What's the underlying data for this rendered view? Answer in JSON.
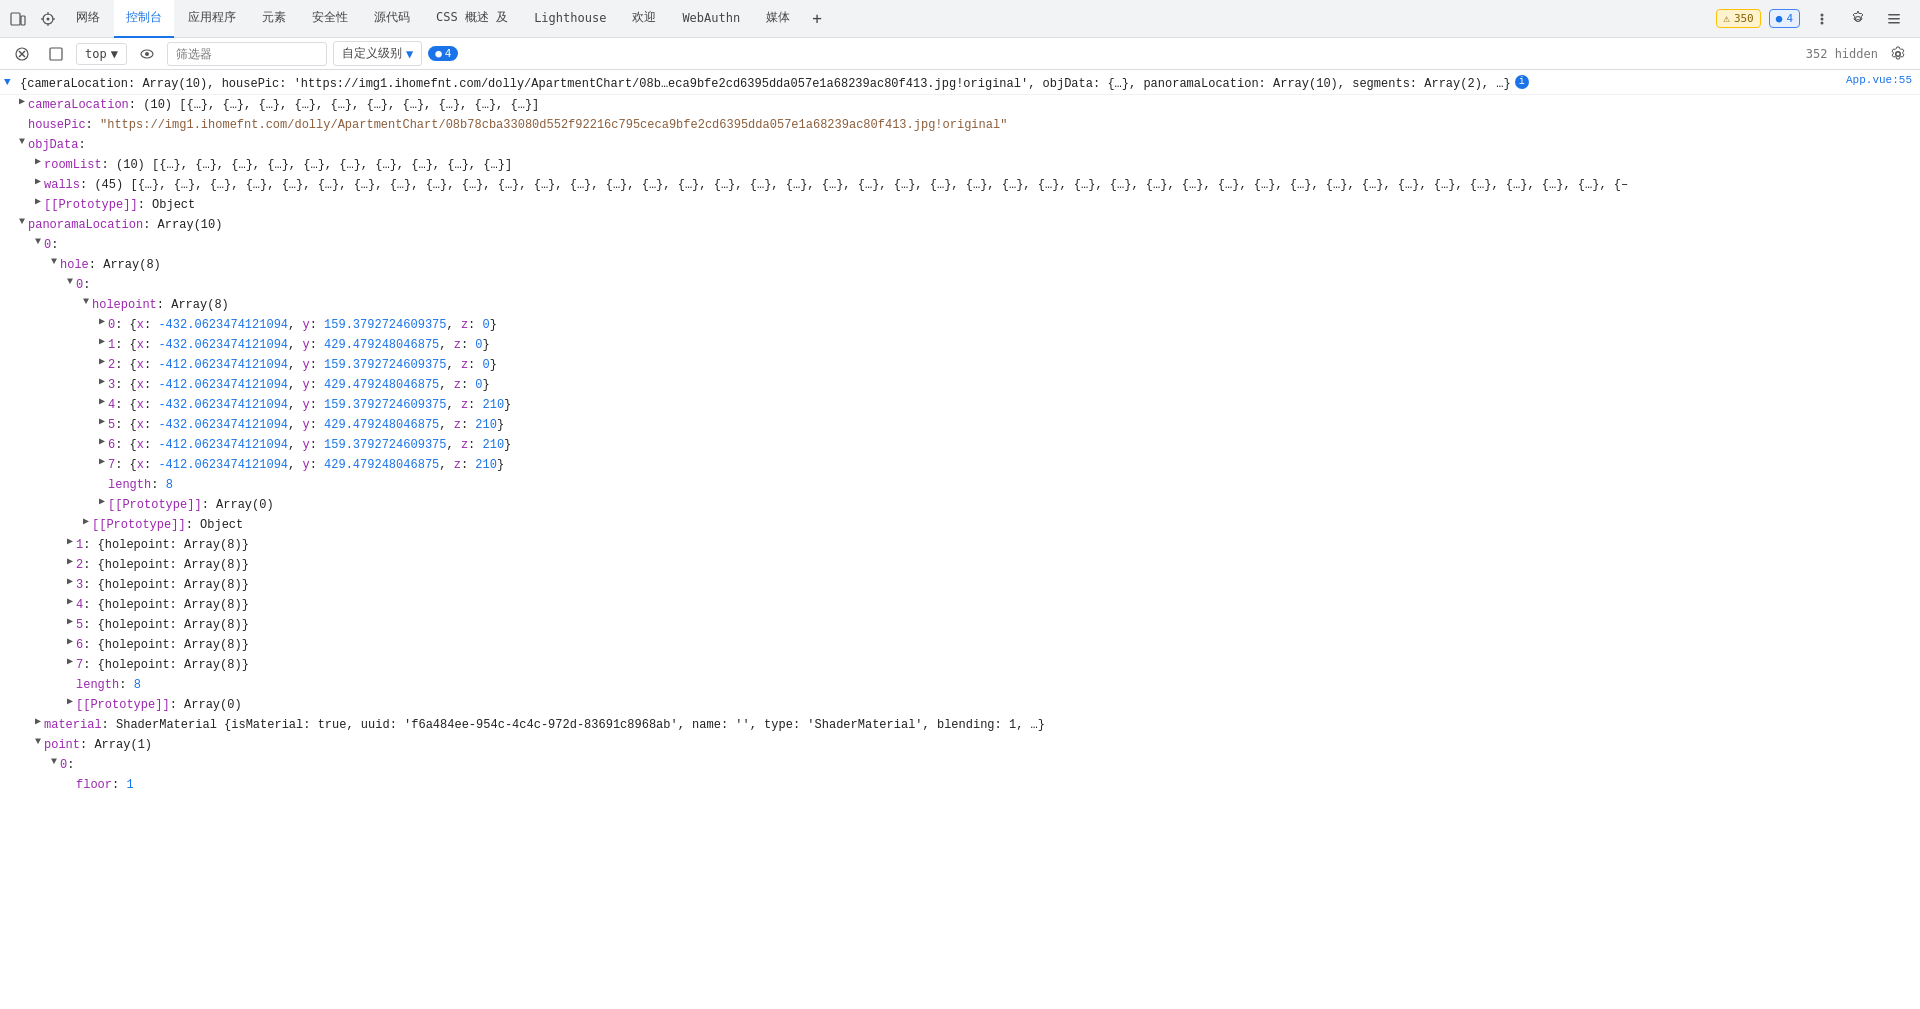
{
  "tabs": [
    {
      "label": "网络",
      "active": false
    },
    {
      "label": "控制台",
      "active": true
    },
    {
      "label": "应用程序",
      "active": false
    },
    {
      "label": "元素",
      "active": false
    },
    {
      "label": "安全性",
      "active": false
    },
    {
      "label": "源代码",
      "active": false
    },
    {
      "label": "CSS 概述 及",
      "active": false
    },
    {
      "label": "Lighthouse",
      "active": false
    },
    {
      "label": "欢迎",
      "active": false
    },
    {
      "label": "WebAuthn",
      "active": false
    },
    {
      "label": "媒体",
      "active": false
    }
  ],
  "topRight": {
    "warningCount": "350",
    "infoCount": "4",
    "hiddenCount": "352 hidden"
  },
  "toolbar": {
    "topLabel": "top",
    "filterPlaceholder": "筛选器",
    "levelLabel": "自定义级别",
    "bubbleCount": "4"
  },
  "source": "App.vue:55",
  "console": {
    "mainLine": "{cameraLocation: Array(10), housePic: 'https://img1.ihomefnt.com/dolly/ApartmentChart/08b…eca9bfe2cd6395dda057e1a68239ac80f413.jpg!original', objData: {…}, panoramaLocation: Array(10), segments: Array(2), …}",
    "lines": [
      {
        "indent": 1,
        "expander": "collapsed",
        "text": "cameraLocation: (10) [{…}, {…}, {…}, {…}, {…}, {…}, {…}, {…}, {…}, {…}]"
      },
      {
        "indent": 1,
        "expander": "none",
        "text": "housePic: \"https://img1.ihomefnt.com/dolly/ApartmentChart/08b78cba33080d552f92216c795ceca9bfe2cd6395dda057e1a68239ac80f413.jpg!original\""
      },
      {
        "indent": 1,
        "expander": "expanded",
        "text": "objData:"
      },
      {
        "indent": 2,
        "expander": "collapsed",
        "text": "roomList: (10) [{…}, {…}, {…}, {…}, {…}, {…}, {…}, {…}, {…}, {…}]"
      },
      {
        "indent": 2,
        "expander": "collapsed",
        "text": "walls: (45) [{…}, {…}, {…}, {…}, {…}, {…}, {…}, {…}, {…}, {…}, {…}, {…}, {…}, {…}, {…}, {…}, {…}, {…}, {…}, {…}, {…}, {…}, {…}, {…}, {…}, {…}, {…}, {…}, {…}, {…}, {…}, {…}, {…}, {…}, {…}, {…}, {…}, {…}, {…}, {…}, {…}, {…}, {…}, {…}, {…}, {…}, {–"
      },
      {
        "indent": 2,
        "expander": "collapsed",
        "text": "[[Prototype]]: Object"
      },
      {
        "indent": 1,
        "expander": "expanded",
        "text": "panoramaLocation: Array(10)"
      },
      {
        "indent": 2,
        "expander": "expanded",
        "text": "0:"
      },
      {
        "indent": 3,
        "expander": "expanded",
        "text": "hole: Array(8)"
      },
      {
        "indent": 4,
        "expander": "expanded",
        "text": "0:"
      },
      {
        "indent": 5,
        "expander": "expanded",
        "text": "holepoint: Array(8)"
      },
      {
        "indent": 6,
        "expander": "collapsed",
        "text": "0: {x: -432.0623474121094, y: 159.3792724609375, z: 0}"
      },
      {
        "indent": 6,
        "expander": "collapsed",
        "text": "1: {x: -432.0623474121094, y: 429.479248046875, z: 0}"
      },
      {
        "indent": 6,
        "expander": "collapsed",
        "text": "2: {x: -412.0623474121094, y: 159.3792724609375, z: 0}"
      },
      {
        "indent": 6,
        "expander": "collapsed",
        "text": "3: {x: -412.0623474121094, y: 429.479248046875, z: 0}"
      },
      {
        "indent": 6,
        "expander": "collapsed",
        "text": "4: {x: -432.0623474121094, y: 159.3792724609375, z: 210}"
      },
      {
        "indent": 6,
        "expander": "collapsed",
        "text": "5: {x: -432.0623474121094, y: 429.479248046875, z: 210}"
      },
      {
        "indent": 6,
        "expander": "collapsed",
        "text": "6: {x: -412.0623474121094, y: 159.3792724609375, z: 210}"
      },
      {
        "indent": 6,
        "expander": "collapsed",
        "text": "7: {x: -412.0623474121094, y: 429.479248046875, z: 210}"
      },
      {
        "indent": 6,
        "expander": "none",
        "text": "length: 8"
      },
      {
        "indent": 6,
        "expander": "collapsed",
        "text": "[[Prototype]]: Array(0)"
      },
      {
        "indent": 5,
        "expander": "collapsed",
        "text": "[[Prototype]]: Object"
      },
      {
        "indent": 4,
        "expander": "collapsed",
        "text": "1: {holepoint: Array(8)}"
      },
      {
        "indent": 4,
        "expander": "collapsed",
        "text": "2: {holepoint: Array(8)}"
      },
      {
        "indent": 4,
        "expander": "collapsed",
        "text": "3: {holepoint: Array(8)}"
      },
      {
        "indent": 4,
        "expander": "collapsed",
        "text": "4: {holepoint: Array(8)}"
      },
      {
        "indent": 4,
        "expander": "collapsed",
        "text": "5: {holepoint: Array(8)}"
      },
      {
        "indent": 4,
        "expander": "collapsed",
        "text": "6: {holepoint: Array(8)}"
      },
      {
        "indent": 4,
        "expander": "collapsed",
        "text": "7: {holepoint: Array(8)}"
      },
      {
        "indent": 4,
        "expander": "none",
        "text": "length: 8"
      },
      {
        "indent": 4,
        "expander": "collapsed",
        "text": "[[Prototype]]: Array(0)"
      },
      {
        "indent": 2,
        "expander": "none",
        "text": "material: ShaderMaterial {isMaterial: true, uuid: 'f6a484ee-954c-4c4c-972d-83691c8968ab', name: '', type: 'ShaderMaterial', blending: 1, …}"
      },
      {
        "indent": 2,
        "expander": "expanded",
        "text": "point: Array(1)"
      },
      {
        "indent": 3,
        "expander": "expanded",
        "text": "0:"
      },
      {
        "indent": 4,
        "expander": "none",
        "text": "floor: 1"
      }
    ]
  }
}
